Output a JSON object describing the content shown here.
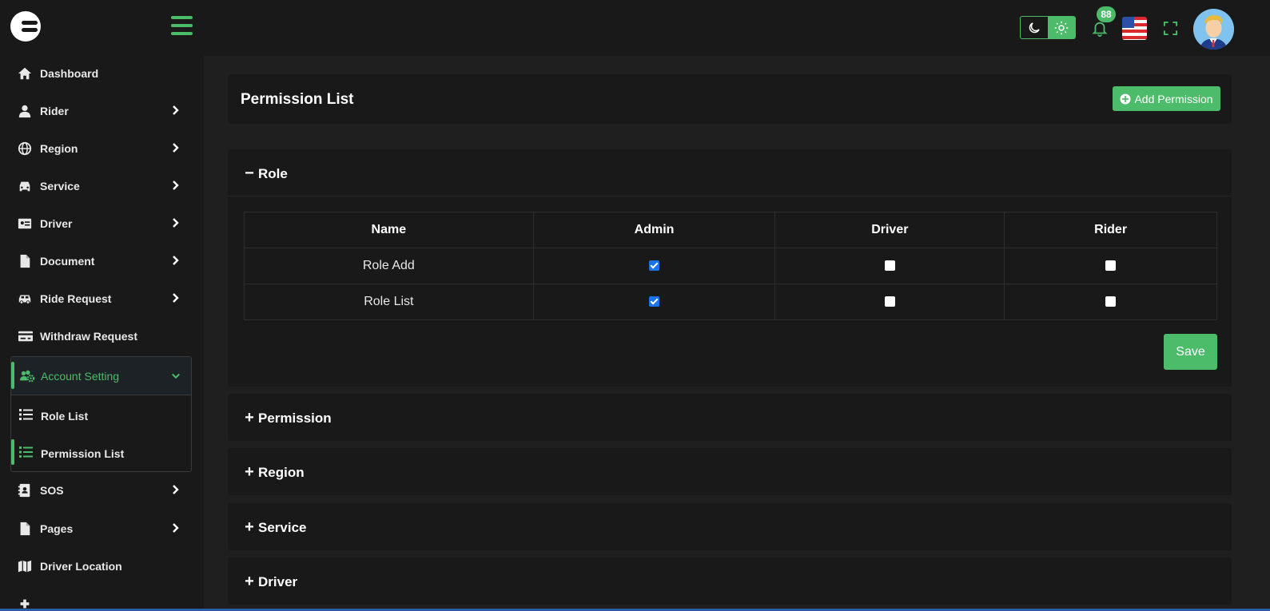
{
  "header": {
    "notification_count": "88",
    "icons": [
      "logo-icon",
      "hamburger-icon",
      "moon-icon",
      "sun-icon",
      "bell-icon",
      "us-flag-icon",
      "fullscreen-icon",
      "avatar"
    ]
  },
  "sidebar": {
    "items": [
      {
        "label": "Dashboard",
        "icon": "home-icon",
        "has_chevron": false
      },
      {
        "label": "Rider",
        "icon": "user-icon",
        "has_chevron": true
      },
      {
        "label": "Region",
        "icon": "globe-icon",
        "has_chevron": true
      },
      {
        "label": "Service",
        "icon": "car-icon",
        "has_chevron": true
      },
      {
        "label": "Driver",
        "icon": "id-card-icon",
        "has_chevron": true
      },
      {
        "label": "Document",
        "icon": "document-icon",
        "has_chevron": true
      },
      {
        "label": "Ride Request",
        "icon": "taxi-icon",
        "has_chevron": true
      },
      {
        "label": "Withdraw Request",
        "icon": "money-icon",
        "has_chevron": false
      }
    ],
    "active_group": {
      "label": "Account Setting",
      "icon": "users-cog-icon",
      "subitems": [
        {
          "label": "Role List",
          "icon": "list-icon",
          "active": false
        },
        {
          "label": "Permission List",
          "icon": "list-icon",
          "active": true
        }
      ]
    },
    "items_after": [
      {
        "label": "SOS",
        "icon": "contact-book-icon",
        "has_chevron": true
      },
      {
        "label": "Pages",
        "icon": "page-icon",
        "has_chevron": true
      },
      {
        "label": "Driver Location",
        "icon": "map-icon",
        "has_chevron": false
      }
    ]
  },
  "main": {
    "page_title": "Permission List",
    "add_button_label": "Add Permission",
    "accordions": [
      {
        "title": "Role",
        "expanded": true,
        "columns": [
          "Name",
          "Admin",
          "Driver",
          "Rider"
        ],
        "rows": [
          {
            "name": "Role Add",
            "admin": true,
            "driver": false,
            "rider": false
          },
          {
            "name": "Role List",
            "admin": true,
            "driver": false,
            "rider": false
          }
        ],
        "save_label": "Save"
      },
      {
        "title": "Permission",
        "expanded": false
      },
      {
        "title": "Region",
        "expanded": false
      },
      {
        "title": "Service",
        "expanded": false
      },
      {
        "title": "Driver",
        "expanded": false
      }
    ]
  },
  "colors": {
    "accent": "#4cbb6a",
    "background": "#1f1f1f",
    "panel": "#191919",
    "checkbox_checked": "#1a73e8"
  }
}
